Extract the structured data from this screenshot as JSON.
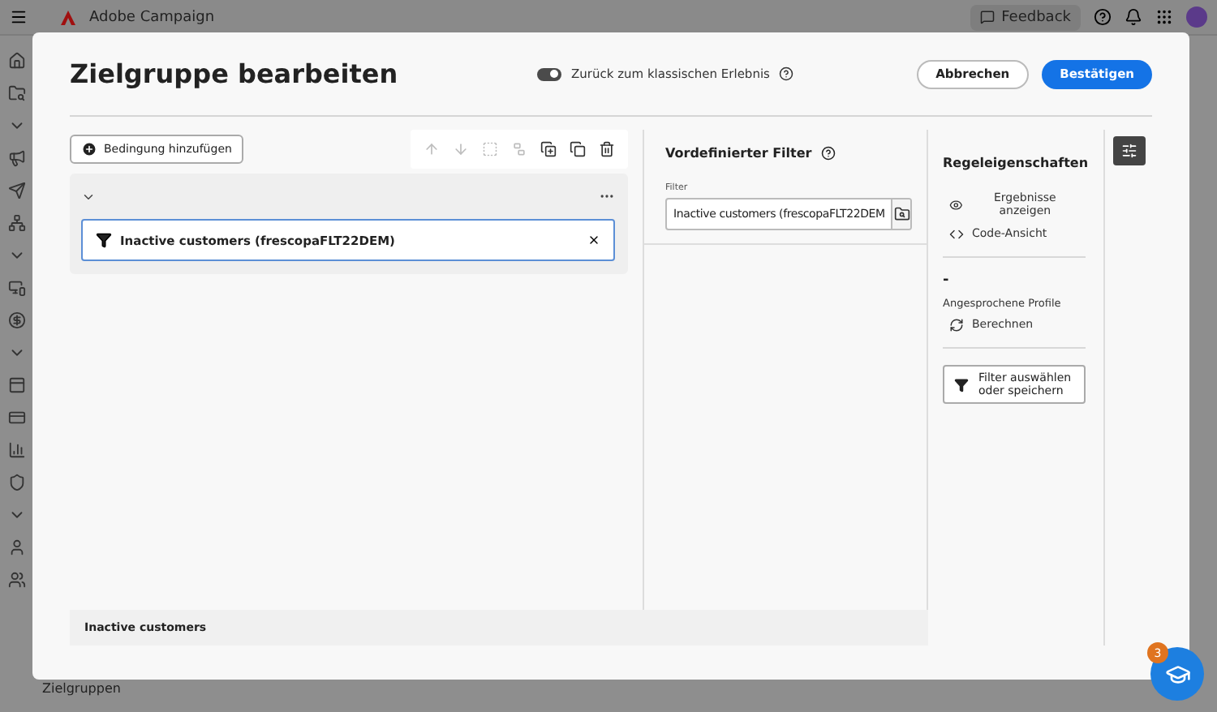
{
  "app_bar": {
    "product": "Adobe Campaign",
    "feedback": "Feedback"
  },
  "sidebar": {
    "label": "Zielgruppen"
  },
  "dialog": {
    "title": "Zielgruppe bearbeiten",
    "toggle": {
      "label": "Zurück zum klassischen Erlebnis",
      "on": true
    },
    "buttons": [
      {
        "label": "Abbrechen",
        "kind": "secondary"
      },
      {
        "label": "Bestätigen",
        "kind": "primary"
      }
    ],
    "add_condition": "Bedingung hinzufügen",
    "toolbar": [
      {
        "kind": "up",
        "disabled": true
      },
      {
        "kind": "down",
        "disabled": true
      },
      {
        "kind": "group",
        "disabled": true
      },
      {
        "kind": "ungroup",
        "disabled": true
      },
      {
        "kind": "duplicate",
        "disabled": false
      },
      {
        "kind": "copy",
        "disabled": false
      },
      {
        "kind": "delete",
        "disabled": false
      }
    ],
    "condition": {
      "text": "Inactive customers (frescopaFLT22DEM)",
      "selected": true
    },
    "predefined_filter": {
      "title": "Vordefinierter Filter",
      "field_label": "Filter",
      "value": "Inactive customers (frescopaFLT22DEM"
    },
    "rule_properties": {
      "title": "Regeleigenschaften",
      "actions": [
        {
          "kind": "view",
          "label": "Ergebnisse anzeigen"
        },
        {
          "kind": "code",
          "label": "Code-Ansicht"
        }
      ],
      "count": "-",
      "profiles_label": "Angesprochene Profile",
      "calculate": "Berechnen",
      "filter_button": "Filter auswählen oder speichern"
    },
    "summary": "Inactive customers"
  },
  "help_badge": "3"
}
